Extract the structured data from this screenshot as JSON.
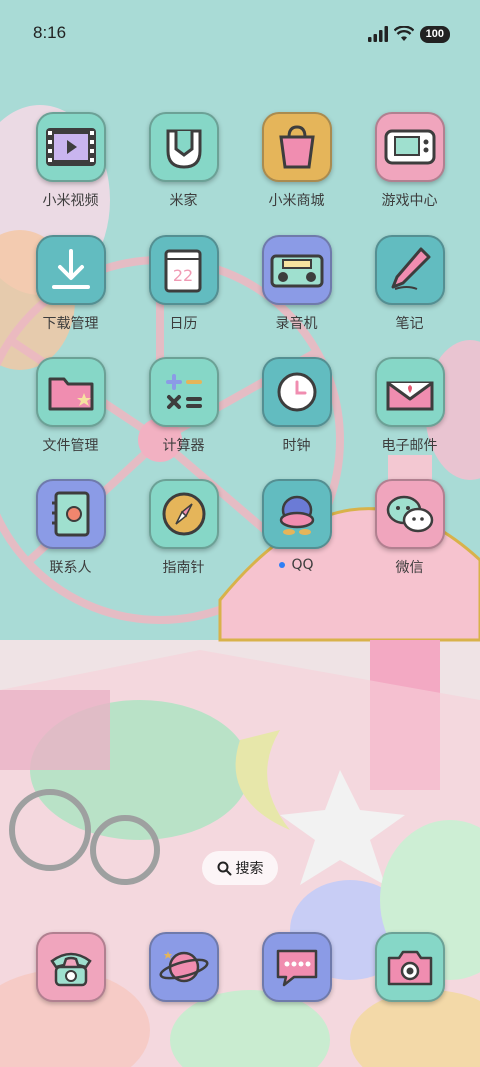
{
  "status_bar": {
    "time": "8:16",
    "battery": "100"
  },
  "apps": [
    {
      "label": "小米视频",
      "icon": "video-icon",
      "bg": "#86d7c7"
    },
    {
      "label": "米家",
      "icon": "mijia-icon",
      "bg": "#86d7c7"
    },
    {
      "label": "小米商城",
      "icon": "shopping-bag-icon",
      "bg": "#e5b55a"
    },
    {
      "label": "游戏中心",
      "icon": "game-console-icon",
      "bg": "#f0a5bd"
    },
    {
      "label": "下载管理",
      "icon": "download-icon",
      "bg": "#62bcc0"
    },
    {
      "label": "日历",
      "icon": "calendar-icon",
      "bg": "#62bcc0",
      "day": "22"
    },
    {
      "label": "录音机",
      "icon": "radio-icon",
      "bg": "#8b9be6"
    },
    {
      "label": "笔记",
      "icon": "pencil-icon",
      "bg": "#62bcc0"
    },
    {
      "label": "文件管理",
      "icon": "folder-icon",
      "bg": "#86d7c7"
    },
    {
      "label": "计算器",
      "icon": "calculator-icon",
      "bg": "#86d7c7"
    },
    {
      "label": "时钟",
      "icon": "clock-icon",
      "bg": "#62bcc0"
    },
    {
      "label": "电子邮件",
      "icon": "mail-icon",
      "bg": "#86d7c7"
    },
    {
      "label": "联系人",
      "icon": "contacts-book-icon",
      "bg": "#8b9be6"
    },
    {
      "label": "指南针",
      "icon": "compass-icon",
      "bg": "#86d7c7"
    },
    {
      "label": "QQ",
      "icon": "qq-penguin-icon",
      "bg": "#62bcc0",
      "new_badge": true
    },
    {
      "label": "微信",
      "icon": "wechat-icon",
      "bg": "#f0a5bd"
    }
  ],
  "search": {
    "label": "搜索"
  },
  "dock": [
    {
      "icon": "phone-icon",
      "bg": "#f0a5bd"
    },
    {
      "icon": "browser-planet-icon",
      "bg": "#8b9be6"
    },
    {
      "icon": "messages-icon",
      "bg": "#8b9be6"
    },
    {
      "icon": "camera-icon",
      "bg": "#86d7c7"
    }
  ]
}
